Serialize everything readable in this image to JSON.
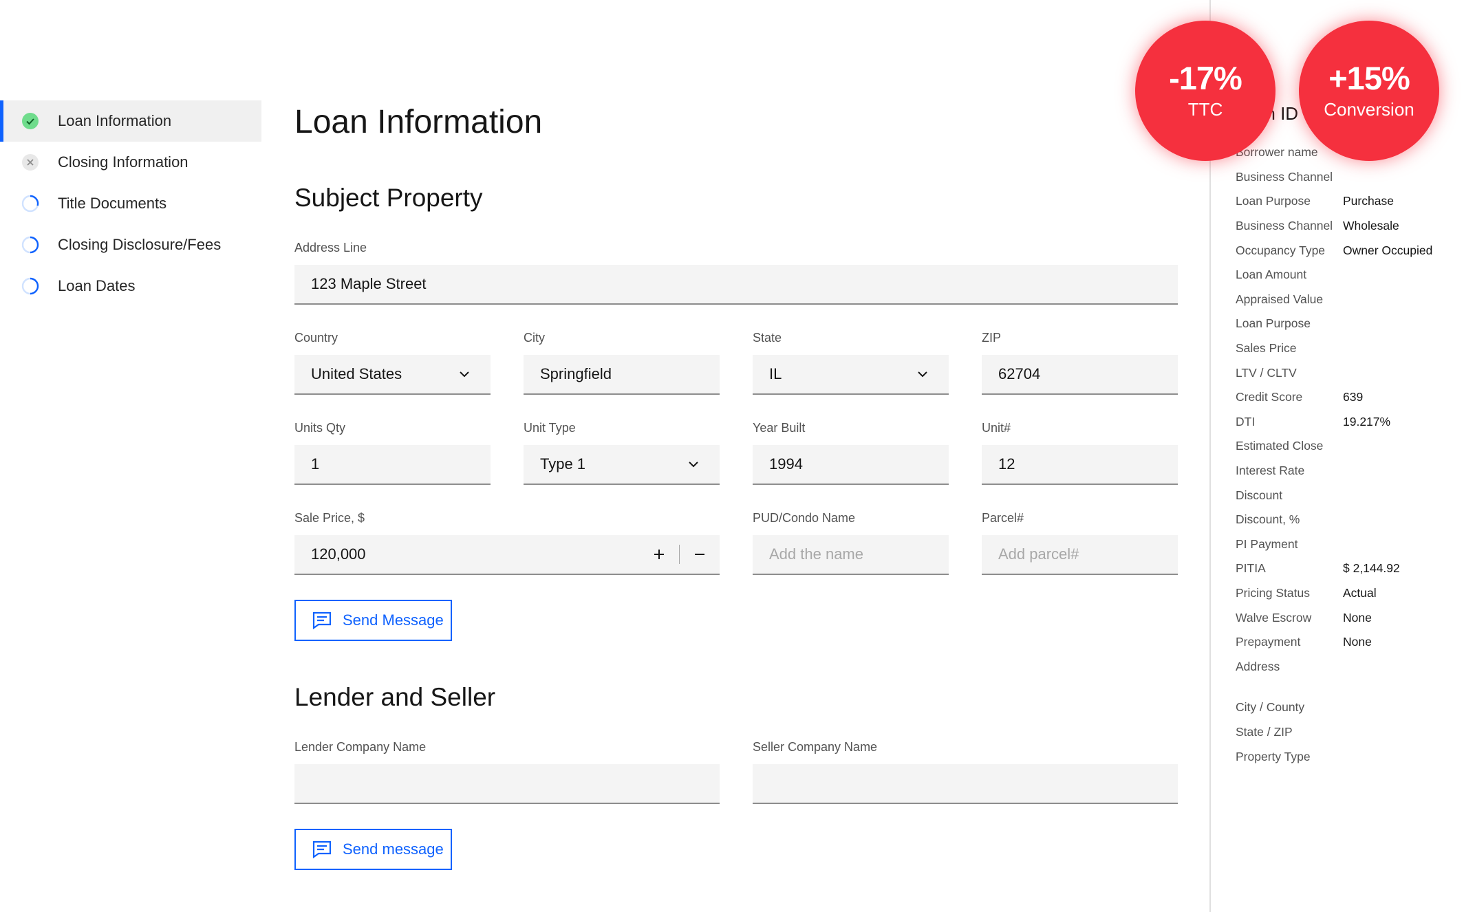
{
  "sidebar": {
    "items": [
      {
        "label": "Loan Information",
        "status": "complete"
      },
      {
        "label": "Closing Information",
        "status": "error"
      },
      {
        "label": "Title Documents",
        "status": "in-progress"
      },
      {
        "label": "Closing Disclosure/Fees",
        "status": "in-progress"
      },
      {
        "label": "Loan Dates",
        "status": "in-progress"
      }
    ]
  },
  "main": {
    "title": "Loan Information",
    "subject_property": {
      "title": "Subject Property",
      "address_label": "Address Line",
      "address_value": "123 Maple Street",
      "country_label": "Country",
      "country_value": "United States",
      "city_label": "City",
      "city_value": "Springfield",
      "state_label": "State",
      "state_value": "IL",
      "zip_label": "ZIP",
      "zip_value": "62704",
      "units_label": "Units Qty",
      "units_value": "1",
      "unit_type_label": "Unit Type",
      "unit_type_value": "Type 1",
      "year_built_label": "Year Built",
      "year_built_value": "1994",
      "unit_no_label": "Unit#",
      "unit_no_value": "12",
      "sale_price_label": "Sale Price, $",
      "sale_price_value": "120,000",
      "pud_label": "PUD/Condo Name",
      "pud_placeholder": "Add the name",
      "parcel_label": "Parcel#",
      "parcel_placeholder": "Add parcel#",
      "send_label": "Send Message"
    },
    "lender_seller": {
      "title": "Lender and Seller",
      "lender_label": "Lender Company Name",
      "lender_value": "",
      "seller_label": "Seller Company Name",
      "seller_value": "",
      "send_label": "Send message"
    }
  },
  "panel": {
    "title": "Loan ID",
    "rows": [
      {
        "key": "Borrower name",
        "value": ""
      },
      {
        "key": "Business Channel",
        "value": ""
      },
      {
        "key": "Loan Purpose",
        "value": "Purchase"
      },
      {
        "key": "Business Channel",
        "value": "Wholesale"
      },
      {
        "key": "Occupancy Type",
        "value": "Owner Occupied"
      },
      {
        "key": "Loan Amount",
        "value": ""
      },
      {
        "key": "Appraised Value",
        "value": ""
      },
      {
        "key": "Loan Purpose",
        "value": ""
      },
      {
        "key": "Sales Price",
        "value": ""
      },
      {
        "key": "LTV / CLTV",
        "value": ""
      },
      {
        "key": "Credit Score",
        "value": "639"
      },
      {
        "key": "DTI",
        "value": "19.217%"
      },
      {
        "key": "Estimated Close",
        "value": ""
      },
      {
        "key": "Interest Rate",
        "value": ""
      },
      {
        "key": "Discount",
        "value": ""
      },
      {
        "key": "Discount, %",
        "value": ""
      },
      {
        "key": "PI Payment",
        "value": ""
      },
      {
        "key": "PITIA",
        "value": "$ 2,144.92"
      },
      {
        "key": "Pricing Status",
        "value": "Actual"
      },
      {
        "key": "Walve Escrow",
        "value": "None"
      },
      {
        "key": "Prepayment",
        "value": "None"
      },
      {
        "key": "Address",
        "value": ""
      },
      {
        "key": "City / County",
        "value": ""
      },
      {
        "key": "State / ZIP",
        "value": ""
      },
      {
        "key": "Property Type",
        "value": ""
      }
    ]
  },
  "badges": {
    "ttc": {
      "value": "-17%",
      "label": "TTC"
    },
    "conversion": {
      "value": "+15%",
      "label": "Conversion"
    }
  },
  "colors": {
    "accent": "#0f62fe",
    "success": "#42be65",
    "badge": "#f5303e"
  }
}
